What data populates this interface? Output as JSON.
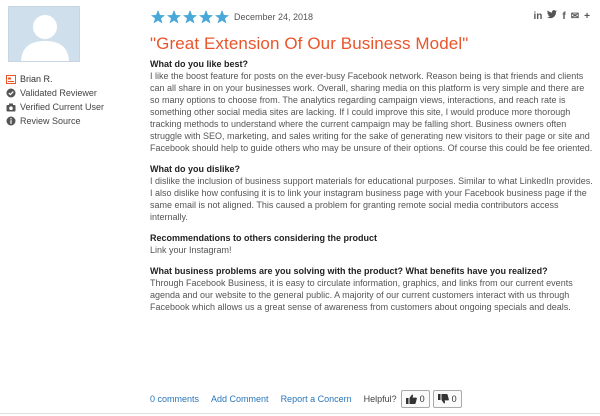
{
  "reviewer": {
    "name": "Brian R.",
    "validated": "Validated Reviewer",
    "verified": "Verified Current User",
    "source": "Review Source"
  },
  "rating": {
    "stars": 5,
    "max": 5
  },
  "date": "December 24, 2018",
  "share_icons": [
    "linkedin-icon",
    "twitter-icon",
    "facebook-icon",
    "email-icon",
    "plus-icon"
  ],
  "share": {
    "linkedin": "in",
    "twitter": "🐦",
    "facebook": "f",
    "email": "✉",
    "plus": "+"
  },
  "title": "\"Great Extension Of Our Business Model\"",
  "sections": [
    {
      "question": "What do you like best?",
      "answer": "I like the boost feature for posts on the ever-busy Facebook network. Reason being is that friends and clients can all share in on your businesses work. Overall, sharing media on this platform is very simple and there are so many options to choose from. The analytics regarding campaign views, interactions, and reach rate is something other social media sites are lacking. If I could improve this site, I would produce more thorough tracking methods to understand where the current campaign may be falling short. Business owners often struggle with SEO, marketing, and sales writing for the sake of generating new visitors to their page or site and Facebook should help to guide others who may be unsure of their options. Of course this could be fee oriented."
    },
    {
      "question": "What do you dislike?",
      "answer": "I dislike the inclusion of business support materials for educational purposes. Similar to what LinkedIn provides. I also dislike how confusing it is to link your instagram business page with your Facebook business page if the same email is not aligned. This caused a problem for granting remote social media contributors access internally."
    },
    {
      "question": "Recommendations to others considering the product",
      "answer": "Link your Instagram!"
    },
    {
      "question": "What business problems are you solving with the product? What benefits have you realized?",
      "answer": "Through Facebook Business, it is easy to circulate information, graphics, and links from our current events agenda and our website to the general public. A majority of our current customers interact with us through Facebook which allows us a great sense of awareness from customers about ongoing specials and deals."
    }
  ],
  "footer": {
    "comments": "0 comments",
    "add_comment": "Add Comment",
    "report": "Report a Concern",
    "helpful": "Helpful?",
    "up_count": "0",
    "down_count": "0"
  },
  "colors": {
    "title": "#e8552b",
    "star": "#49a8d8",
    "link": "#2b76b9",
    "avatar_bg": "#cfe0ec"
  }
}
